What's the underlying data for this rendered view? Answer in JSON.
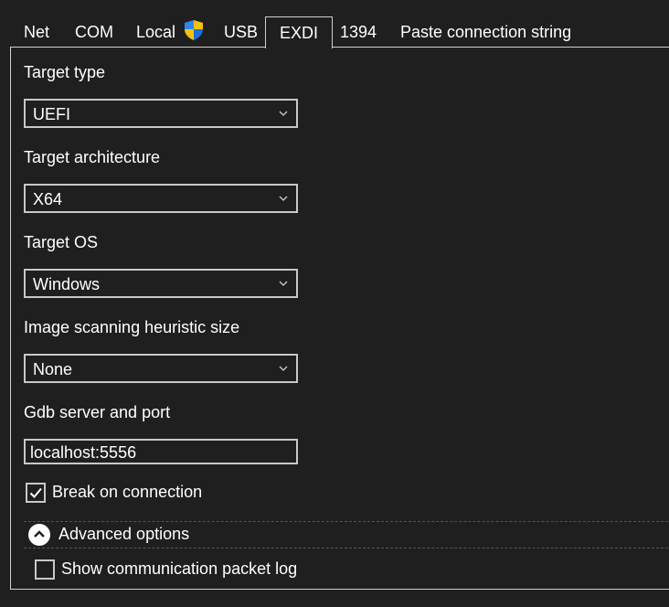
{
  "tabs": [
    {
      "label": "Net"
    },
    {
      "label": "COM"
    },
    {
      "label": "Local"
    },
    {
      "label": "USB"
    },
    {
      "label": "EXDI",
      "active": true
    },
    {
      "label": "1394"
    },
    {
      "label": "Paste connection string"
    }
  ],
  "form": {
    "target_type": {
      "label": "Target type",
      "value": "UEFI"
    },
    "target_arch": {
      "label": "Target architecture",
      "value": "X64"
    },
    "target_os": {
      "label": "Target OS",
      "value": "Windows"
    },
    "heuristic": {
      "label": "Image scanning heuristic size",
      "value": "None"
    },
    "gdb": {
      "label": "Gdb server and port",
      "value": "localhost:5556"
    },
    "break_on_connection": {
      "label": "Break on connection",
      "checked": true
    },
    "advanced": {
      "label": "Advanced options",
      "expanded": true
    },
    "show_packet_log": {
      "label": "Show communication packet log",
      "checked": false
    }
  },
  "colors": {
    "background": "#1f1f1f",
    "border": "#cfcfcf",
    "text": "#ffffff",
    "shield_blue": "#1e6fd9",
    "shield_yellow": "#f4c20d"
  },
  "icons": {
    "local_tab": "uac-shield-icon",
    "dropdown": "chevron-down-icon",
    "advanced_toggle": "chevron-up-circle-icon",
    "checkbox": "checkmark-icon"
  }
}
